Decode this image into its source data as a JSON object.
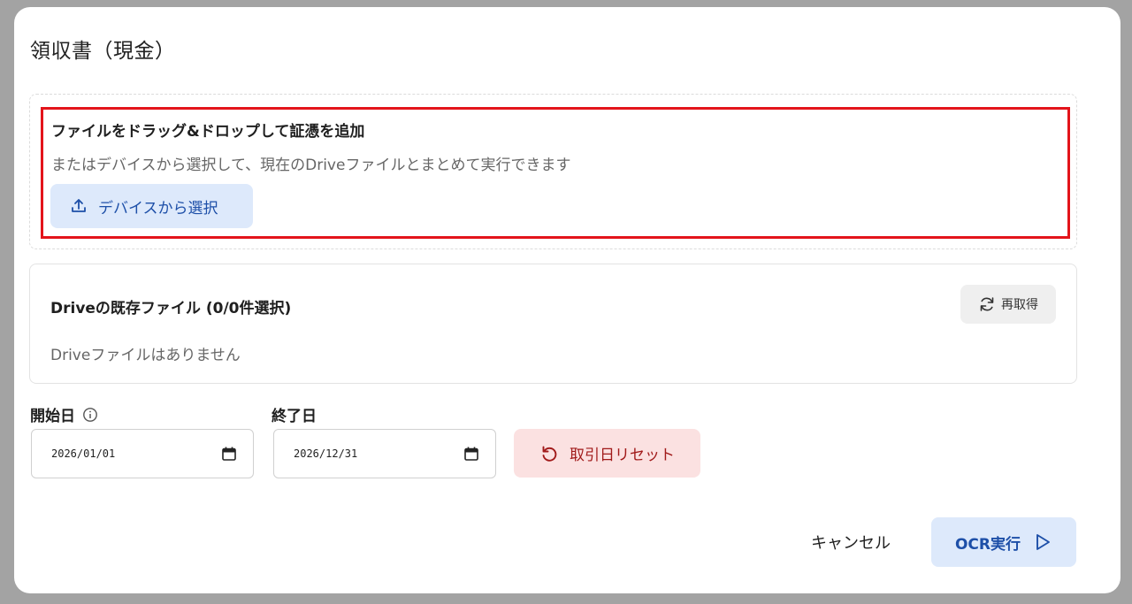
{
  "dialog": {
    "title": "領収書（現金）"
  },
  "upload": {
    "heading": "ファイルをドラッグ&ドロップして証憑を追加",
    "subtext": "またはデバイスから選択して、現在のDriveファイルとまとめて実行できます",
    "select_button_label": "デバイスから選択",
    "select_button_icon": "upload-icon"
  },
  "drive": {
    "title": "Driveの既存ファイル (0/0件選択)",
    "empty_message": "Driveファイルはありません",
    "refresh_button_label": "再取得",
    "refresh_button_icon": "refresh-icon"
  },
  "dates": {
    "start_label": "開始日",
    "start_value": "2026/01/01",
    "end_label": "終了日",
    "end_value": "2026/12/31",
    "reset_button_label": "取引日リセット",
    "reset_button_icon": "undo-icon"
  },
  "footer": {
    "cancel_label": "キャンセル",
    "ocr_label": "OCR実行",
    "ocr_icon": "play-icon"
  },
  "colors": {
    "highlight_border": "#e3141b",
    "primary_bg": "#dde9fb",
    "primary_text": "#1d4fa8",
    "danger_bg": "#fbe1e1",
    "danger_text": "#a11a1a"
  }
}
